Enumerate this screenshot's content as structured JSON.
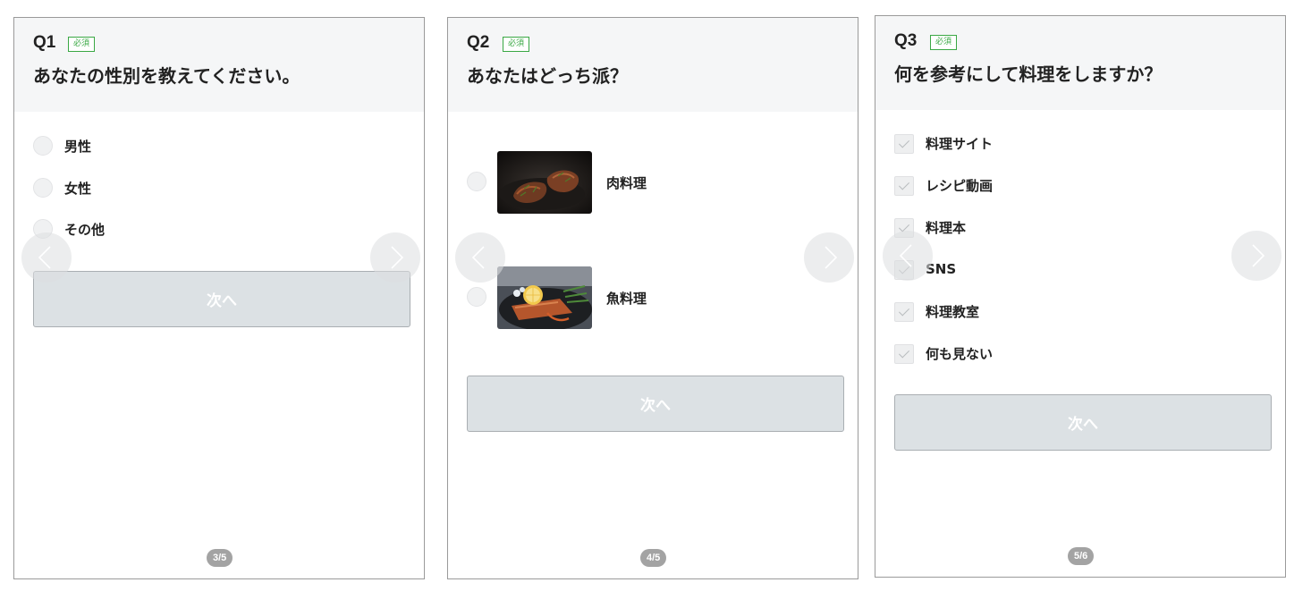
{
  "panels": [
    {
      "qnum": "Q1",
      "required": "必須",
      "question": "あなたの性別を教えてください。",
      "options": [
        "男性",
        "女性",
        "その他"
      ],
      "next": "次へ",
      "pager": "3/5"
    },
    {
      "qnum": "Q2",
      "required": "必須",
      "question": "あなたはどっち派？",
      "options": [
        "肉料理",
        "魚料理"
      ],
      "next": "次へ",
      "pager": "4/5"
    },
    {
      "qnum": "Q3",
      "required": "必須",
      "question": "何を参考にして料理をしますか？",
      "options": [
        "料理サイト",
        "レシピ動画",
        "料理本",
        "SNS",
        "料理教室",
        "何も見ない"
      ],
      "next": "次へ",
      "pager": "5/6"
    }
  ],
  "icons": {
    "prev": "chevron-left-icon",
    "next": "chevron-right-icon"
  },
  "colors": {
    "required_badge": "#3aa844",
    "button_bg": "#dce1e4",
    "pager_bg": "#a3a3a3",
    "header_bg": "#f5f6f7"
  }
}
